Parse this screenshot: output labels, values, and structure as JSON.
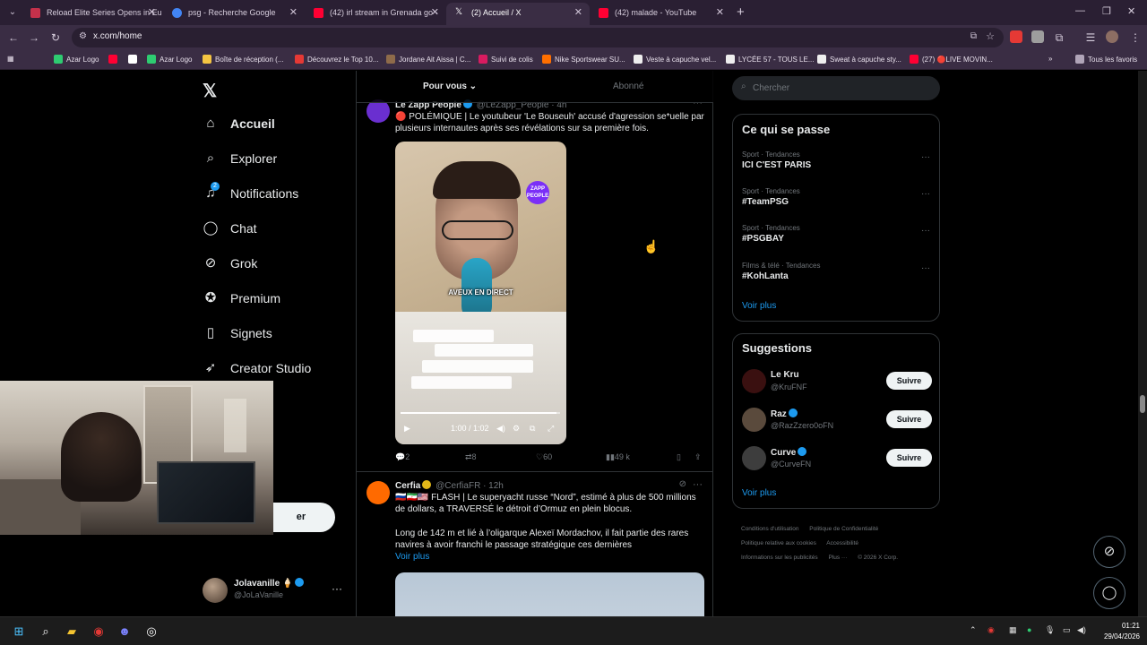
{
  "browser": {
    "tabs": [
      {
        "title": "Reload Elite Series Opens in Eu",
        "color": "#c4314b"
      },
      {
        "title": "psg - Recherche Google",
        "color": "#4285f4"
      },
      {
        "title": "(42) irl stream in Grenada go -",
        "color": "#ff0033"
      },
      {
        "title": "(2) Accueil / X",
        "color": "#ffffff"
      },
      {
        "title": "(42) malade - YouTube",
        "color": "#ff0033"
      }
    ],
    "url": "x.com/home",
    "bookmarks": [
      {
        "label": "Azar Logo",
        "color": "#2ecc71"
      },
      {
        "label": "",
        "color": "#ff0033"
      },
      {
        "label": "",
        "color": "#ffffff"
      },
      {
        "label": "Azar Logo",
        "color": "#2ecc71"
      },
      {
        "label": "Boîte de réception (...",
        "color": "#f5c542"
      },
      {
        "label": "Découvrez le Top 10...",
        "color": "#e53935"
      },
      {
        "label": "Jordane Ait Aissa | C...",
        "color": "#8e6b4a"
      },
      {
        "label": "Suivi de colis",
        "color": "#d81b60"
      },
      {
        "label": "Nike Sportswear SU...",
        "color": "#ff6f00"
      },
      {
        "label": "Veste à capuche vel...",
        "color": "#eeeeee"
      },
      {
        "label": "LYCÉE 57 - TOUS LE...",
        "color": "#eeeeee"
      },
      {
        "label": "Sweat à capuche sty...",
        "color": "#eeeeee"
      },
      {
        "label": "(27) 🔴LIVE MOVIN...",
        "color": "#ff0033"
      }
    ],
    "all_bookmarks": "Tous les favoris"
  },
  "nav": {
    "items": [
      {
        "label": "Accueil",
        "icon": "home-icon",
        "glyph": "⌂"
      },
      {
        "label": "Explorer",
        "icon": "search-icon",
        "glyph": "⌕"
      },
      {
        "label": "Notifications",
        "icon": "bell-icon",
        "glyph": "🔔"
      },
      {
        "label": "Chat",
        "icon": "chat-icon",
        "glyph": "◯"
      },
      {
        "label": "Grok",
        "icon": "grok-icon",
        "glyph": "⊘"
      },
      {
        "label": "Premium",
        "icon": "premium-icon",
        "glyph": "✪"
      },
      {
        "label": "Signets",
        "icon": "bookmark-icon",
        "glyph": "▯"
      },
      {
        "label": "Creator Studio",
        "icon": "rocket-icon",
        "glyph": "➶"
      }
    ],
    "notif_badge": "2",
    "post_button_partial": "er"
  },
  "account": {
    "name": "Jolavanille",
    "handle": "@JoLaVanille"
  },
  "feed": {
    "tabs": [
      "Pour vous",
      "Abonné"
    ],
    "tweet1": {
      "author": "Le Zapp People",
      "handle": "@LeZapp_People · 4h",
      "text": "🔴 POLÉMIQUE | Le youtubeur 'Le Bouseuh' accusé d'agression se*uelle par plusieurs internautes après ses révélations sur sa première fois.",
      "video_caption": "AVEUX EN DIRECT",
      "video_logo": "ZAPP PEOPLE",
      "video_time": "1:00 / 1:02",
      "video_progress": 0.98,
      "replies": "2",
      "reposts": "8",
      "likes": "60",
      "views": "49 k"
    },
    "tweet2": {
      "author": "Cerfia",
      "handle": "@CerfiaFR · 12h",
      "text1": "🇷🇺🇮🇷🇺🇸 FLASH | Le superyacht russe “Nord”, estimé à plus de 500 millions de dollars, a TRAVERSÉ le détroit d’Ormuz en plein blocus.",
      "text2": "Long de 142 m et lié à l’oligarque Alexeï Mordachov, il fait partie des rares navires à avoir franchi le passage stratégique ces dernières",
      "more": "Voir plus"
    }
  },
  "sidebar": {
    "search_placeholder": "Chercher",
    "trends_title": "Ce qui se passe",
    "trends": [
      {
        "meta": "Sport · Tendances",
        "title": "ICI C'EST PARIS"
      },
      {
        "meta": "Sport · Tendances",
        "title": "#TeamPSG"
      },
      {
        "meta": "Sport · Tendances",
        "title": "#PSGBAY"
      },
      {
        "meta": "Films & télé · Tendances",
        "title": "#KohLanta"
      }
    ],
    "trends_more": "Voir plus",
    "suggestions_title": "Suggestions",
    "suggestions": [
      {
        "name": "Le Kru",
        "handle": "@KruFNF",
        "button": "Suivre",
        "color": "#3a1010"
      },
      {
        "name": "Raz",
        "handle": "@RazZzero0oFN",
        "button": "Suivre",
        "color": "#5a4a3c"
      },
      {
        "name": "Curve",
        "handle": "@CurveFN",
        "button": "Suivre",
        "color": "#3d3d3d"
      }
    ],
    "suggestions_more": "Voir plus",
    "footer": [
      "Conditions d'utilisation",
      "Politique de Confidentialité",
      "Politique relative aux cookies",
      "Accessibilité",
      "Informations sur les publicités",
      "Plus ···",
      "© 2026 X Corp."
    ]
  },
  "taskbar": {
    "time": "01:21",
    "date": "29/04/2026"
  }
}
